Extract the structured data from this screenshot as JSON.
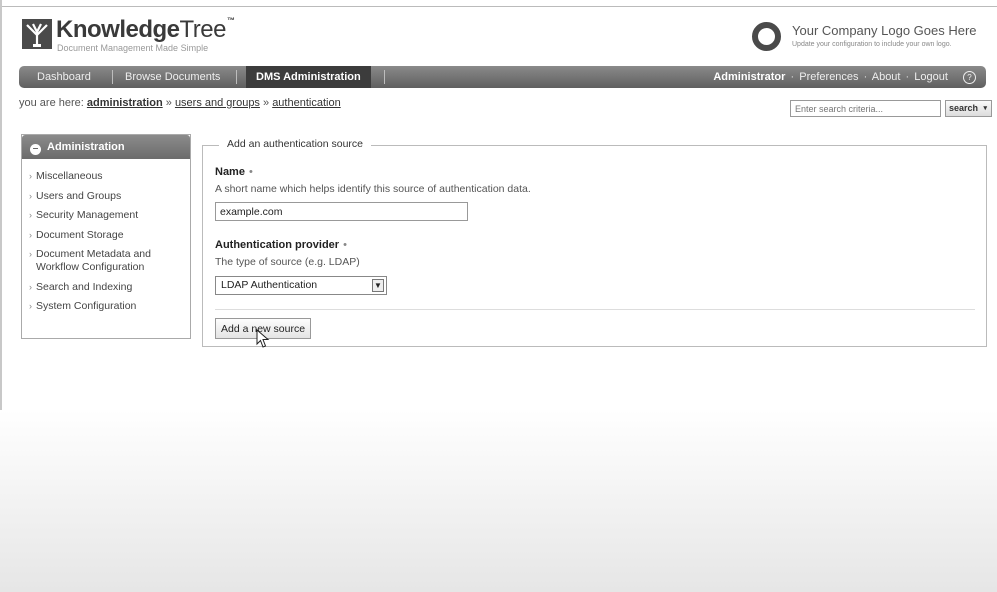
{
  "brand": {
    "name_bold": "Knowledge",
    "name_light": "Tree",
    "tm": "™",
    "tagline": "Document Management Made Simple"
  },
  "company": {
    "title": "Your Company Logo Goes Here",
    "subtitle": "Update your configuration to include your own logo."
  },
  "nav": {
    "tabs": [
      {
        "label": "Dashboard"
      },
      {
        "label": "Browse Documents"
      },
      {
        "label": "DMS Administration",
        "active": true
      }
    ],
    "user": "Administrator",
    "links": [
      "Preferences",
      "About",
      "Logout"
    ],
    "help_glyph": "?"
  },
  "breadcrumb": {
    "prefix": "you are here:",
    "items": [
      "administration",
      "users and groups",
      "authentication"
    ],
    "separator": "»"
  },
  "search": {
    "placeholder": "Enter search criteria...",
    "button_label": "search",
    "arrow": "▾"
  },
  "sidebar": {
    "title": "Administration",
    "items": [
      {
        "label": "Miscellaneous"
      },
      {
        "label": "Users and Groups"
      },
      {
        "label": "Security Management"
      },
      {
        "label": "Document Storage"
      },
      {
        "label": "Document Metadata and Workflow Configuration"
      },
      {
        "label": "Search and Indexing"
      },
      {
        "label": "System Configuration"
      }
    ]
  },
  "form": {
    "legend": "Add an authentication source",
    "name_label": "Name",
    "required_mark": "•",
    "name_desc": "A short name which helps identify this source of authentication data.",
    "name_value": "example.com",
    "provider_label": "Authentication provider",
    "provider_desc": "The type of source (e.g. LDAP)",
    "provider_value": "LDAP Authentication",
    "submit_label": "Add a new source"
  },
  "colors": {
    "navbar": "#6b6b6b",
    "active_tab": "#3c3c3c",
    "sidebar_head": "#777777"
  }
}
